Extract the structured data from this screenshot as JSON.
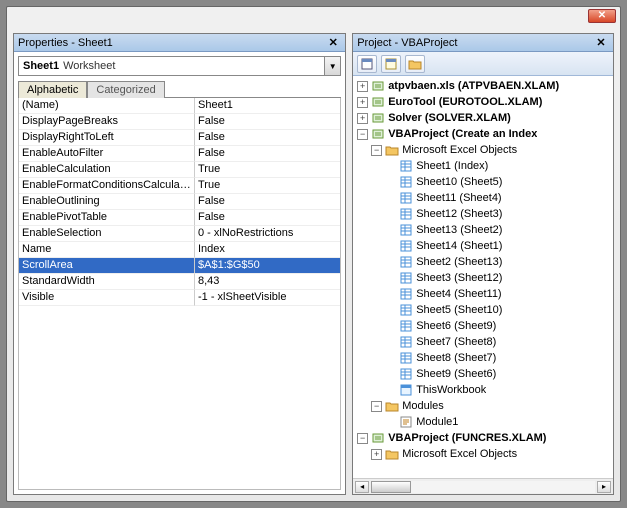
{
  "properties": {
    "title": "Properties - Sheet1",
    "object_name": "Sheet1",
    "object_type": "Worksheet",
    "tabs": [
      "Alphabetic",
      "Categorized"
    ],
    "active_tab": 0,
    "selected_row": 9,
    "rows": [
      {
        "name": "(Name)",
        "value": "Sheet1"
      },
      {
        "name": "DisplayPageBreaks",
        "value": "False"
      },
      {
        "name": "DisplayRightToLeft",
        "value": "False"
      },
      {
        "name": "EnableAutoFilter",
        "value": "False"
      },
      {
        "name": "EnableCalculation",
        "value": "True"
      },
      {
        "name": "EnableFormatConditionsCalculation",
        "value": "True"
      },
      {
        "name": "EnableOutlining",
        "value": "False"
      },
      {
        "name": "EnablePivotTable",
        "value": "False"
      },
      {
        "name": "EnableSelection",
        "value": "0 - xlNoRestrictions"
      },
      {
        "name": "Name",
        "value": "Index"
      },
      {
        "name": "ScrollArea",
        "value": "$A$1:$G$50"
      },
      {
        "name": "StandardWidth",
        "value": "8,43"
      },
      {
        "name": "Visible",
        "value": "-1 - xlSheetVisible"
      }
    ]
  },
  "project": {
    "title": "Project - VBAProject",
    "toolbar_icons": [
      "view-code-icon",
      "view-object-icon",
      "folder-icon"
    ],
    "tree": [
      {
        "label": "atpvbaen.xls (ATPVBAEN.XLAM)",
        "bold": true,
        "icon": "vbproj",
        "exp": "+"
      },
      {
        "label": "EuroTool (EUROTOOL.XLAM)",
        "bold": true,
        "icon": "vbproj",
        "exp": "+"
      },
      {
        "label": "Solver (SOLVER.XLAM)",
        "bold": true,
        "icon": "vbproj",
        "exp": "+"
      },
      {
        "label": "VBAProject (Create an Index",
        "bold": true,
        "icon": "vbproj",
        "exp": "-",
        "children": [
          {
            "label": "Microsoft Excel Objects",
            "icon": "folder",
            "exp": "-",
            "children": [
              {
                "label": "Sheet1 (Index)",
                "icon": "sheet"
              },
              {
                "label": "Sheet10 (Sheet5)",
                "icon": "sheet"
              },
              {
                "label": "Sheet11 (Sheet4)",
                "icon": "sheet"
              },
              {
                "label": "Sheet12 (Sheet3)",
                "icon": "sheet"
              },
              {
                "label": "Sheet13 (Sheet2)",
                "icon": "sheet"
              },
              {
                "label": "Sheet14 (Sheet1)",
                "icon": "sheet"
              },
              {
                "label": "Sheet2 (Sheet13)",
                "icon": "sheet"
              },
              {
                "label": "Sheet3 (Sheet12)",
                "icon": "sheet"
              },
              {
                "label": "Sheet4 (Sheet11)",
                "icon": "sheet"
              },
              {
                "label": "Sheet5 (Sheet10)",
                "icon": "sheet"
              },
              {
                "label": "Sheet6 (Sheet9)",
                "icon": "sheet"
              },
              {
                "label": "Sheet7 (Sheet8)",
                "icon": "sheet"
              },
              {
                "label": "Sheet8 (Sheet7)",
                "icon": "sheet"
              },
              {
                "label": "Sheet9 (Sheet6)",
                "icon": "sheet"
              },
              {
                "label": "ThisWorkbook",
                "icon": "workbook"
              }
            ]
          },
          {
            "label": "Modules",
            "icon": "folder",
            "exp": "-",
            "children": [
              {
                "label": "Module1",
                "icon": "module"
              }
            ]
          }
        ]
      },
      {
        "label": "VBAProject (FUNCRES.XLAM)",
        "bold": true,
        "icon": "vbproj",
        "exp": "-",
        "children": [
          {
            "label": "Microsoft Excel Objects",
            "icon": "folder",
            "exp": "+"
          }
        ]
      }
    ]
  }
}
